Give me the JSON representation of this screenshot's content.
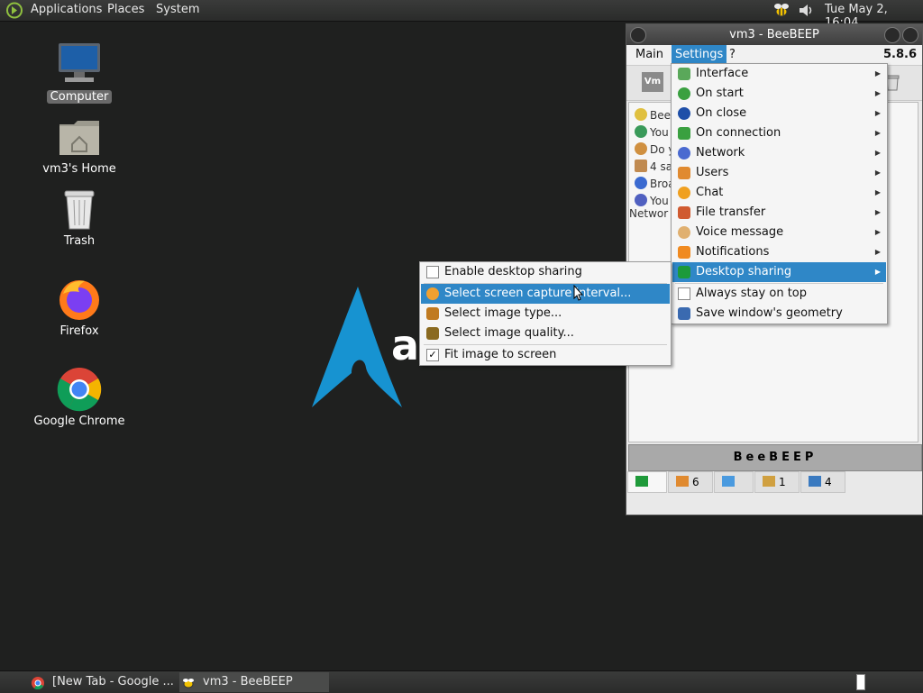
{
  "top_panel": {
    "menus": [
      "Applications",
      "Places",
      "System"
    ],
    "clock": "Tue May  2, 16:04"
  },
  "desktop": {
    "icons": [
      {
        "label": "Computer"
      },
      {
        "label": "vm3's Home"
      },
      {
        "label": "Trash"
      },
      {
        "label": "Firefox"
      },
      {
        "label": "Google Chrome"
      }
    ],
    "wallpaper_text": "a"
  },
  "window": {
    "title": "vm3 - BeeBEEP",
    "menubar": {
      "main": "Main",
      "settings": "Settings",
      "help": "?",
      "version": "5.8.6"
    },
    "toolbar_badge": "Vm",
    "chat_rows": [
      "Bee",
      "You",
      "Do y",
      "4 sa",
      "Broa",
      "You",
      "Networ"
    ],
    "banner": "BeeBEEP",
    "tabs": [
      {
        "label": ""
      },
      {
        "label": "6"
      },
      {
        "label": ""
      },
      {
        "label": "1"
      },
      {
        "label": "4"
      }
    ]
  },
  "settings_menu": {
    "items": [
      {
        "label": "Interface",
        "icon": "interface-icon",
        "submenu": true
      },
      {
        "label": "On start",
        "icon": "start-icon",
        "submenu": true
      },
      {
        "label": "On close",
        "icon": "close-power-icon",
        "submenu": true
      },
      {
        "label": "On connection",
        "icon": "connection-icon",
        "submenu": true
      },
      {
        "label": "Network",
        "icon": "network-icon",
        "submenu": true
      },
      {
        "label": "Users",
        "icon": "users-icon",
        "submenu": true
      },
      {
        "label": "Chat",
        "icon": "chat-icon",
        "submenu": true
      },
      {
        "label": "File transfer",
        "icon": "file-transfer-icon",
        "submenu": true
      },
      {
        "label": "Voice message",
        "icon": "microphone-icon",
        "submenu": true
      },
      {
        "label": "Notifications",
        "icon": "bell-icon",
        "submenu": true
      },
      {
        "label": "Desktop sharing",
        "icon": "desktop-icon",
        "submenu": true,
        "highlighted": true
      },
      {
        "label": "Always stay on top",
        "icon": "checkbox",
        "submenu": false
      },
      {
        "label": "Save window's geometry",
        "icon": "save-geometry-icon",
        "submenu": false
      }
    ]
  },
  "desktop_sharing_menu": {
    "items": [
      {
        "label": "Enable desktop sharing",
        "checked": false
      },
      {
        "label": "Select screen capture interval...",
        "highlighted": true
      },
      {
        "label": "Select image type..."
      },
      {
        "label": "Select image quality..."
      },
      {
        "label": "Fit image to screen",
        "checked": true
      }
    ],
    "check_mark": "✓"
  },
  "taskbar": {
    "tasks": [
      {
        "title": "[New Tab - Google ..."
      },
      {
        "title": "vm3 - BeeBEEP"
      }
    ]
  }
}
